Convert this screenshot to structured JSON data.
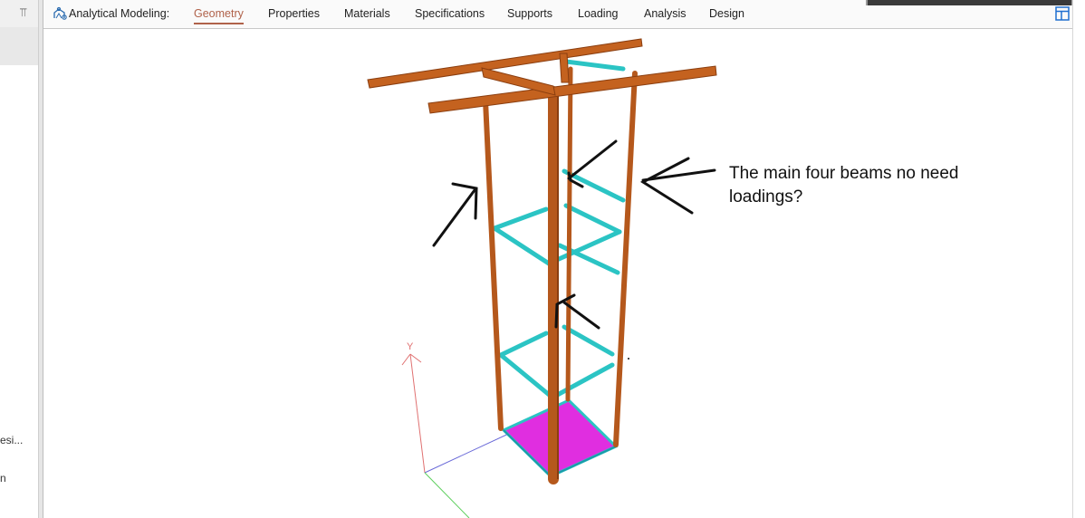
{
  "left_panel": {
    "pin_icon": "pin-icon",
    "fragment_1": "esi...",
    "fragment_2": "n"
  },
  "ribbon": {
    "app_icon": "analytical-modeling-icon",
    "title": "Analytical Modeling:",
    "tabs": [
      {
        "label": "Geometry",
        "active": true
      },
      {
        "label": "Properties",
        "active": false
      },
      {
        "label": "Materials",
        "active": false
      },
      {
        "label": "Specifications",
        "active": false
      },
      {
        "label": "Supports",
        "active": false
      },
      {
        "label": "Loading",
        "active": false
      },
      {
        "label": "Analysis",
        "active": false
      },
      {
        "label": "Design",
        "active": false
      }
    ],
    "layout_icon": "page-layout-icon"
  },
  "viewport": {
    "axis_label_y": "Y",
    "annotation": {
      "line1": "The main four beams no need",
      "line2": "loadings?"
    }
  },
  "colors": {
    "tab_active": "#b0624a",
    "beam_steel": "#b5581c",
    "bracing": "#2bc4c4",
    "base_plate": "#e02ee0",
    "axis_y": "#e07070",
    "axis_x": "#6a6ad8",
    "axis_z": "#5ccf5c"
  }
}
